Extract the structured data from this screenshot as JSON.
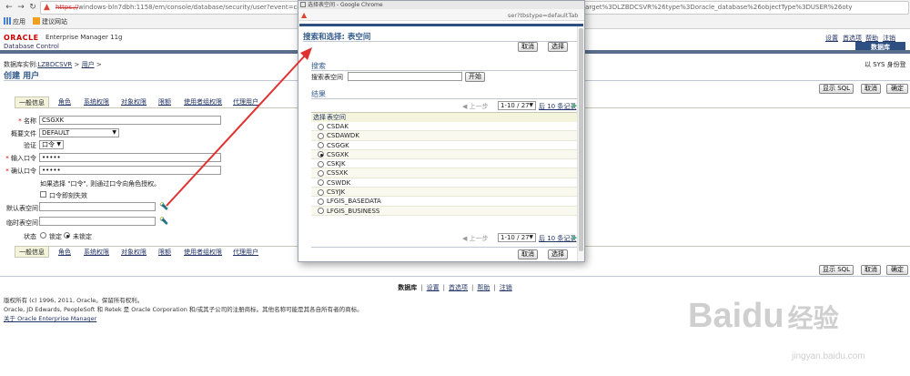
{
  "browser": {
    "url_prefix": "https://",
    "url_visible": "windows-bln7dbh:1158/em/console/database/security/user?event=cr",
    "url_tail": "lartEvent%3Dcreate%26target%3DLZBDCSVR%26type%3Doracle_database%26objectType%3DUSER%26oty",
    "bookmarks": [
      "应用",
      "建议网站"
    ]
  },
  "header": {
    "brand_oracle": "ORACLE",
    "brand_em": "Enterprise Manager 11g",
    "brand_dbc": "Database Control",
    "links": [
      "设置",
      "首选项",
      "帮助",
      "注销"
    ],
    "db_tab": "数据库",
    "breadcrumb_prefix": "数据库实例:",
    "breadcrumb_db": "LZBDCSVR",
    "breadcrumb_sep": ">",
    "breadcrumb_users": "用户",
    "logged_in_as": "以 SYS 身份登",
    "page_title": "创建 用户"
  },
  "actions": {
    "show_sql": "显示 SQL",
    "cancel": "取消",
    "ok": "确定"
  },
  "tabs": [
    "一般信息",
    "角色",
    "系统权限",
    "对象权限",
    "限额",
    "使用者组权限",
    "代理用户"
  ],
  "form": {
    "name_label": "名称",
    "name_value": "CSGXK",
    "profile_label": "概要文件",
    "profile_value": "DEFAULT",
    "auth_label": "验证",
    "auth_value": "口令",
    "password_label": "输入口令",
    "password_value": "•••••",
    "confirm_label": "确认口令",
    "confirm_value": "•••••",
    "hint": "如果选择 \"口令\", 则通过口令向角色授权。",
    "expire_label": "口令即刻失效",
    "default_ts_label": "默认表空间",
    "temp_ts_label": "临时表空间",
    "status_label": "状态",
    "status_locked": "锁定",
    "status_unlocked": "未锁定"
  },
  "footer": {
    "links": [
      "数据库",
      "设置",
      "首选项",
      "帮助",
      "注销"
    ],
    "copyright": "版权所有 (c) 1996, 2011, Oracle。保留所有权利。",
    "trademark": "Oracle, JD Edwards, PeopleSoft 和 Retek 是 Oracle Corporation 和/或其子公司的注册商标。其他名称可能是其各自所有者的商标。",
    "about": "关于 Oracle Enterprise Manager"
  },
  "popup": {
    "window_title": "选择表空间 - Google Chrome",
    "url_tail": "ser?tbstype=defaultTab",
    "heading": "搜索和选择: 表空间",
    "cancel": "取消",
    "select": "选择",
    "search_section": "搜索",
    "search_label": "搜索表空间",
    "search_value": "",
    "go_button": "开始",
    "results_section": "结果",
    "prev_label": "上一步",
    "range_value": "1-10 / 27",
    "next_label": "后 10 条记录",
    "col_select": "选择",
    "col_tablespace": "表空间",
    "rows": [
      "CSDAK",
      "CSDAWDK",
      "CSGGK",
      "CSGXK",
      "CSKJK",
      "CSSXK",
      "CSWDK",
      "CSYJK",
      "LFGIS_BASEDATA",
      "LFGIS_BUSINESS"
    ],
    "selected_row": "CSGXK"
  },
  "watermark": {
    "brand": "Baidu",
    "brand_cn": "经验",
    "site": "jingyan.baidu.com"
  },
  "colors": {
    "oracle_red": "#c00000",
    "link_blue": "#223366",
    "heading_blue": "#365d8c",
    "arrow_red": "#e03030"
  }
}
